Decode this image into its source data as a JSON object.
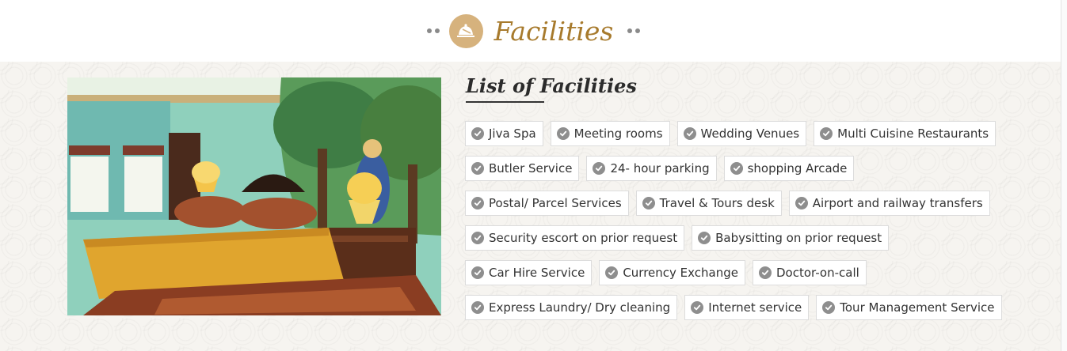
{
  "header": {
    "title": "Facilities"
  },
  "photo": {
    "alt": "Hotel room"
  },
  "list": {
    "title": "List of Facilities",
    "rows": [
      [
        "Jiva Spa",
        "Meeting rooms",
        "Wedding Venues",
        "Multi Cuisine Restaurants"
      ],
      [
        "Butler Service",
        "24- hour parking",
        "shopping Arcade"
      ],
      [
        "Postal/ Parcel Services",
        "Travel & Tours desk",
        "Airport and railway transfers"
      ],
      [
        "Security escort on prior request",
        "Babysitting on prior request"
      ],
      [
        "Car Hire Service",
        "Currency Exchange",
        "Doctor-on-call"
      ],
      [
        "Express Laundry/ Dry cleaning",
        "Internet service",
        "Tour Management Service"
      ]
    ]
  },
  "colors": {
    "accent": "#a77a2c",
    "badge": "#d6b27d",
    "check": "#8e8e8e"
  },
  "icons": {
    "heading_icon": "service-bell-icon",
    "tag_icon": "check-circle-icon"
  }
}
